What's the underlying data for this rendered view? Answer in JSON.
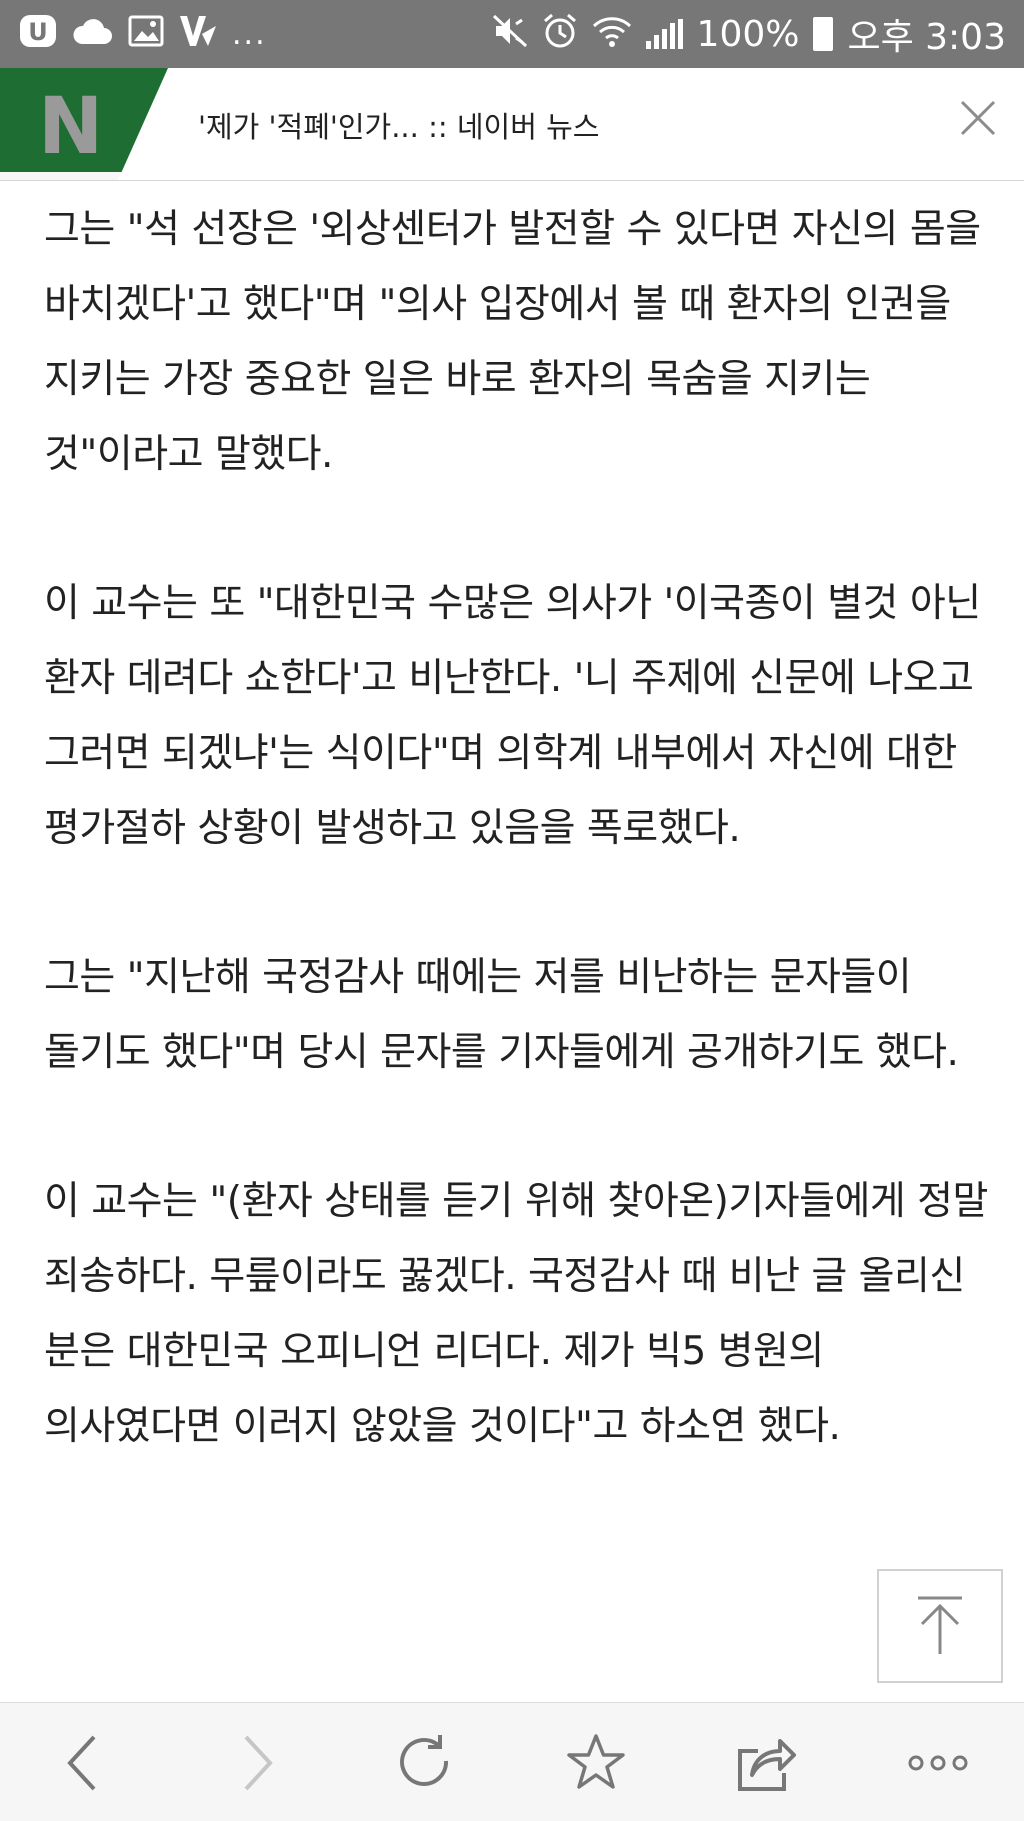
{
  "status_bar": {
    "left_icons": [
      "u-plus-icon",
      "cloud-icon",
      "image-icon",
      "v-app-icon"
    ],
    "more": "...",
    "battery_percent": "100%",
    "time": "오후 3:03"
  },
  "tab": {
    "logo_letter": "N",
    "title": "'제가 '적폐'인가... :: 네이버 뉴스"
  },
  "article": {
    "paragraphs": [
      "그는 \"석 선장은 '외상센터가 발전할 수 있다면 자신의 몸을 바치겠다'고 했다\"며 \"의사 입장에서 볼 때 환자의 인권을 지키는 가장 중요한 일은 바로 환자의 목숨을 지키는 것\"이라고 말했다.",
      "이 교수는 또 \"대한민국 수많은 의사가 '이국종이 별것 아닌 환자 데려다 쇼한다'고 비난한다. '니 주제에 신문에 나오고 그러면 되겠냐'는 식이다\"며 의학계 내부에서 자신에 대한 평가절하 상황이 발생하고 있음을 폭로했다.",
      "그는 \"지난해 국정감사 때에는 저를 비난하는 문자들이 돌기도 했다\"며 당시 문자를 기자들에게 공개하기도 했다.",
      "이 교수는 \"(환자 상태를 듣기 위해 찾아온)기자들에게 정말 죄송하다. 무릎이라도 꿇겠다. 국정감사 때 비난 글 올리신 분은 대한민국 오피니언 리더다. 제가 빅5 병원의 의사였다면 이러지 않았을 것이다\"고 하소연 했다."
    ]
  },
  "bottom_nav": [
    "back-icon",
    "forward-icon",
    "refresh-icon",
    "bookmark-star-icon",
    "share-icon",
    "more-icon"
  ]
}
